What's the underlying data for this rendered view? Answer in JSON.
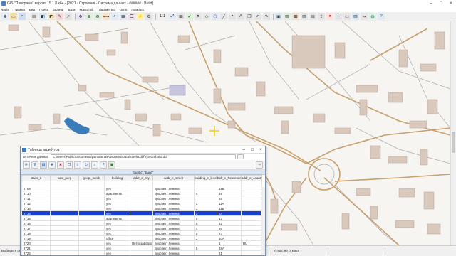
{
  "window": {
    "title": "GIS \"Панорама\" версия 15.1.8 x64 - [2021 - Строения - Система данных - ###### - Build]",
    "min_label": "–",
    "max_label": "□",
    "close_label": "×"
  },
  "menu": {
    "items": [
      "Файл",
      "Правка",
      "Вид",
      "Поиск",
      "Задачи",
      "База",
      "Масштаб",
      "Параметры",
      "Окно",
      "Помощь"
    ]
  },
  "toolbar": {
    "scale_label": "1:1",
    "icons": [
      "new-icon",
      "open-icon",
      "save-icon",
      "print-icon",
      "layers-icon",
      "select-icon",
      "edit-icon",
      "cursor-icon",
      "pan-icon",
      "zoom-in-icon",
      "zoom-out-icon",
      "measure-icon",
      "search-icon",
      "table-icon",
      "legend-icon",
      "lightning-icon",
      "settings-icon",
      "globe-icon"
    ]
  },
  "map": {
    "colors": {
      "background": "#f6f5f1",
      "building": "#d9c8bc",
      "building_outline": "#b9a393",
      "road_main": "#c89f6e",
      "road_minor": "#a7a7a7",
      "water": "#3a7bb8",
      "marker": "#f0d000"
    }
  },
  "status": {
    "left_text": "Выберите объект",
    "right_text": "Атлас не открыт"
  },
  "dialog": {
    "title": "Таблица атрибутов",
    "source_label": "Источник данных:",
    "source_path": "C:\\Users\\Public\\Documents\\panorama\\Panorama\\Data\\karelia.dbf\\ryazan\\build.dbf",
    "table_name": "\"public\".\"build\"",
    "columns": [
      "stairs_1",
      "func_purp",
      "geopl_numb",
      "building",
      "addr_e_city",
      "addr_e_street",
      "building_e_levels",
      "bldr_e_housenumb",
      "addr_e_country"
    ],
    "rows": [
      [
        "2709",
        "",
        "",
        "yes",
        "",
        "проспект Ленина",
        "",
        "19Б",
        ""
      ],
      [
        "2710",
        "",
        "",
        "apartments",
        "",
        "проспект Ленина",
        "4",
        "39",
        ""
      ],
      [
        "2711",
        "",
        "",
        "yes",
        "",
        "проспект Ленина",
        "",
        "25",
        ""
      ],
      [
        "2712",
        "",
        "",
        "yes",
        "",
        "проспект Ленина",
        "2",
        "11А",
        ""
      ],
      [
        "2713",
        "",
        "",
        "yes",
        "",
        "проспект Ленина",
        "2",
        "11Б",
        ""
      ],
      [
        "2714",
        "",
        "",
        "yes",
        "",
        "проспект Ленина",
        "2",
        "24",
        ""
      ],
      [
        "2715",
        "",
        "",
        "apartments",
        "",
        "проспект Ленина",
        "5",
        "13",
        ""
      ],
      [
        "2716",
        "",
        "",
        "yes",
        "",
        "проспект Ленина",
        "5",
        "32",
        ""
      ],
      [
        "2717",
        "",
        "",
        "yes",
        "",
        "проспект Ленина",
        "4",
        "26",
        ""
      ],
      [
        "2718",
        "",
        "",
        "yes",
        "",
        "проспект Ленина",
        "5",
        "27",
        ""
      ],
      [
        "2719",
        "",
        "",
        "office",
        "",
        "проспект Ленина",
        "2",
        "10А",
        ""
      ],
      [
        "2720",
        "",
        "",
        "yes",
        "Петрозаводск",
        "проспект Ленина",
        "",
        "1",
        "RU"
      ],
      [
        "2721",
        "",
        "",
        "yes",
        "",
        "проспект Ленина",
        "5",
        "28А",
        ""
      ],
      [
        "2722",
        "",
        "",
        "yes",
        "",
        "проспект Ленина",
        "",
        "21",
        ""
      ]
    ],
    "selected_row": 5
  }
}
